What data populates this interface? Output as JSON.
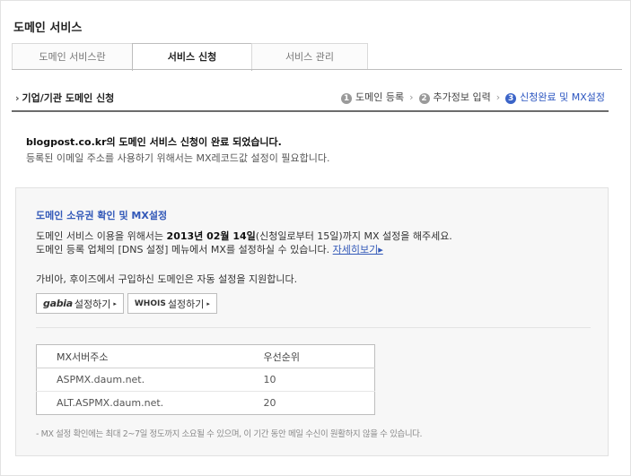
{
  "page": {
    "title": "도메인 서비스"
  },
  "tabs": [
    {
      "label": "도메인 서비스란"
    },
    {
      "label": "서비스 신청",
      "active": true
    },
    {
      "label": "서비스 관리"
    }
  ],
  "section": {
    "arrow": "›",
    "title": "기업/기관 도메인 신청"
  },
  "steps": [
    {
      "num": "1",
      "label": "도메인 등록"
    },
    {
      "num": "2",
      "label": "추가정보 입력"
    },
    {
      "num": "3",
      "label": "신청완료 및 MX설정",
      "active": true
    }
  ],
  "step_separator": "›",
  "complete": {
    "title": "blogpost.co.kr의 도메인 서비스 신청이 완료 되었습니다.",
    "desc": "등록된 이메일 주소를 사용하기 위해서는 MX레코드값 설정이 필요합니다."
  },
  "box": {
    "title": "도메인 소유권 확인 및 MX설정",
    "line1_pre": "도메인 서비스 이용을 위해서는 ",
    "line1_bold": "2013년 02월 14일",
    "line1_post": "(신청일로부터 15일)까지 MX 설정을 해주세요.",
    "line2": "도메인 등록 업체의 [DNS 설정] 메뉴에서 MX를 설정하실 수 있습니다.",
    "detail_link": "자세히보기▸",
    "line3": "가비아, 후이즈에서 구입하신 도메인은 자동 설정을 지원합니다.",
    "buttons": [
      {
        "logo": "gabia",
        "label": "설정하기",
        "caret": "▸"
      },
      {
        "logo": "WHOIS",
        "label": "설정하기",
        "caret": "▸"
      }
    ],
    "table": {
      "headers": [
        "MX서버주소",
        "우선순위"
      ],
      "rows": [
        [
          "ASPMX.daum.net.",
          "10"
        ],
        [
          "ALT.ASPMX.daum.net.",
          "20"
        ]
      ]
    },
    "note": "- MX 설정 확인에는 최대 2~7일 정도까지 소요될 수 있으며, 이 기간 동안 메일 수신이 원활하지 않을 수 있습니다."
  },
  "colors": {
    "accent_blue": "#3359b8",
    "step_active": "#3b64c8",
    "box_bg": "#f7f7f7"
  }
}
